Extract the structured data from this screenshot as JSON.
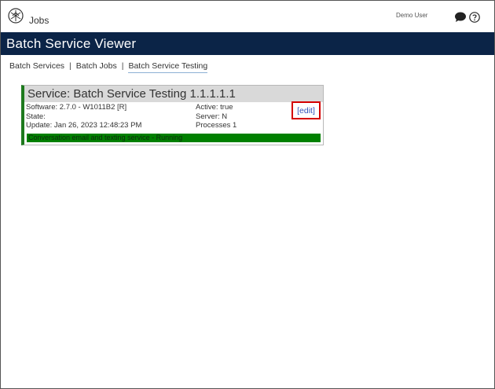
{
  "app": {
    "name": "Jobs",
    "user": "Demo User",
    "icons": {
      "logo": "compass-logo-icon",
      "chat": "chat-icon",
      "help": "help-icon"
    }
  },
  "header": {
    "title": "Batch Service Viewer",
    "background": "#0b2447"
  },
  "breadcrumb": {
    "items": [
      "Batch Services",
      "Batch Jobs",
      "Batch Service Testing"
    ],
    "separator": "|"
  },
  "service": {
    "title": "Service: Batch Service Testing 1.1.1.1.1",
    "software": "Software: 2.7.0 - W1011B2 [R]",
    "state": "State:",
    "update": "Update: Jan 26, 2023 12:48:23 PM",
    "active": "Active: true",
    "server": "Server: N",
    "processes": "Processes 1",
    "edit_label": "[edit]",
    "status_text": "Conversation email and texting service - Running",
    "status_color": "#008000"
  }
}
